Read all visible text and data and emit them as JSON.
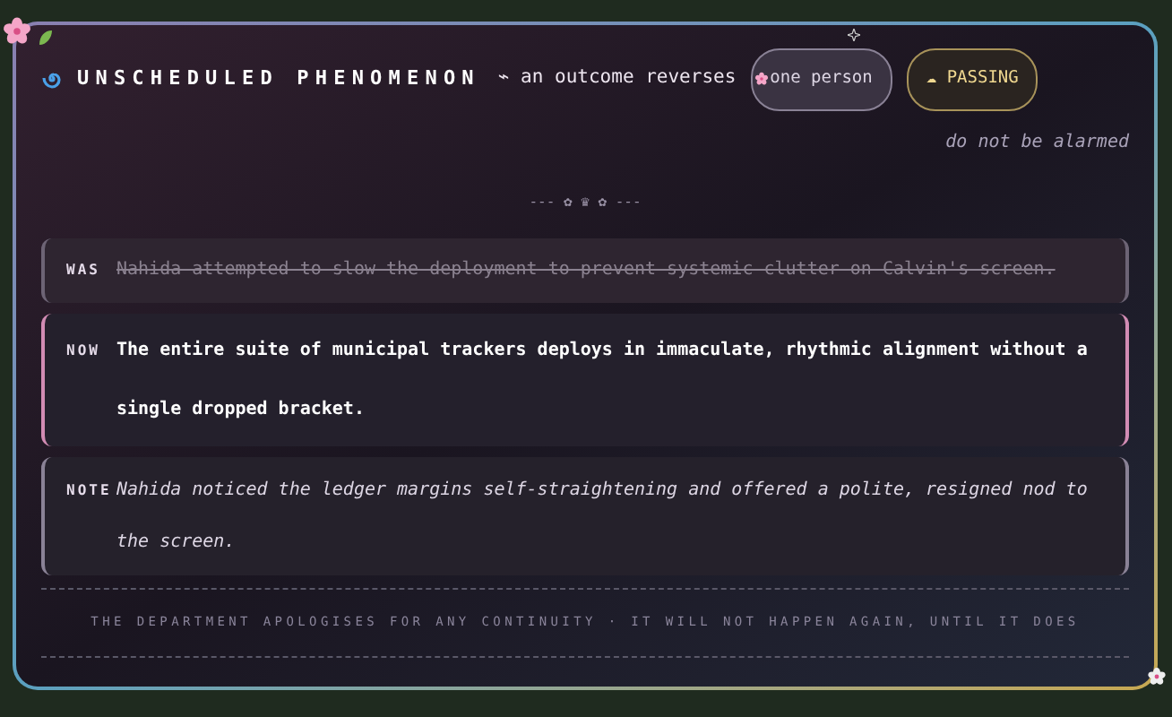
{
  "header": {
    "title": "UNSCHEDULED PHENOMENON",
    "subtitle": "⌁ an outcome reverses",
    "pills": [
      {
        "kind": "scope",
        "label": "one person"
      },
      {
        "kind": "status",
        "label": "☁ PASSING"
      }
    ]
  },
  "notice": "do not be alarmed",
  "divider": "--- ✿ ♛ ✿ ---",
  "entries": [
    {
      "kind": "was",
      "label": "WAS",
      "text": "Nahida attempted to slow the deployment to prevent systemic clutter on Calvin's screen."
    },
    {
      "kind": "now",
      "label": "NOW",
      "text": "The entire suite of municipal trackers deploys in immaculate, rhythmic alignment without a single dropped bracket."
    },
    {
      "kind": "note",
      "label": "NOTE",
      "text": "Nahida noticed the ledger margins self-straightening and offered a polite, resigned nod to the screen."
    }
  ],
  "footer": "THE DEPARTMENT APOLOGISES FOR ANY CONTINUITY · IT WILL NOT HAPPEN AGAIN, UNTIL IT DOES"
}
